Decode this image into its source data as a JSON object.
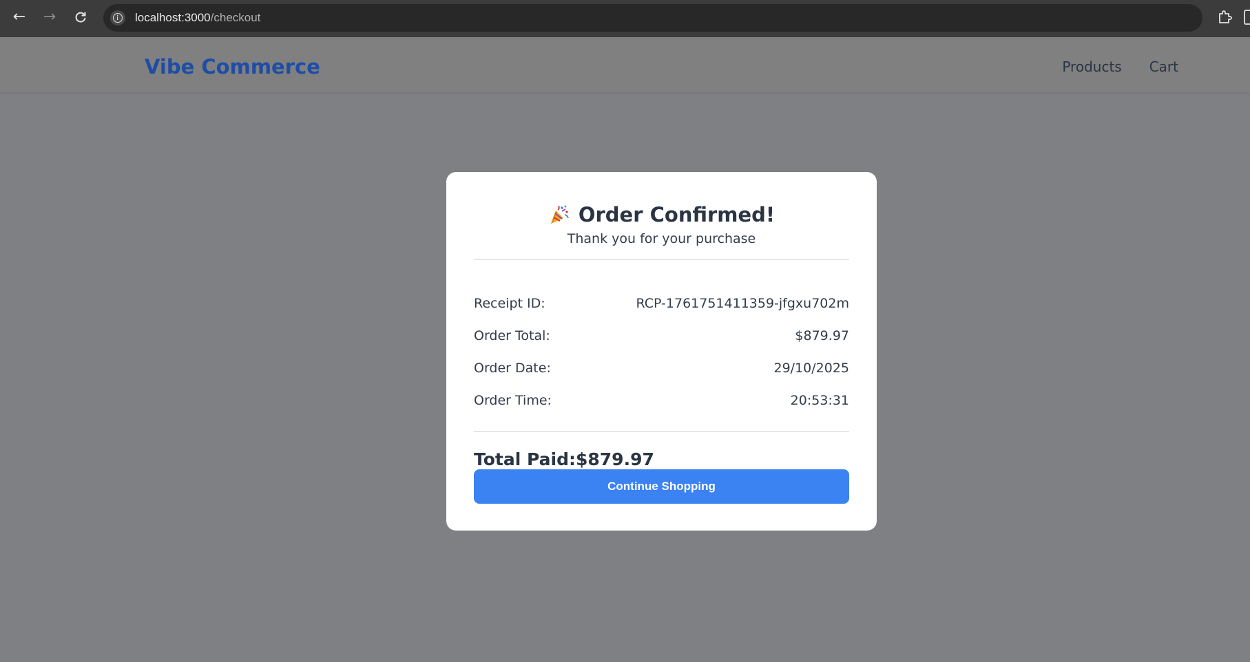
{
  "browser": {
    "url_host": "localhost:3000",
    "url_path": "/checkout"
  },
  "header": {
    "brand": "Vibe Commerce",
    "brand_color": "#1e4da6",
    "nav": [
      {
        "label": "Products"
      },
      {
        "label": "Cart"
      }
    ]
  },
  "modal": {
    "icon": "party-popper-icon",
    "title": "Order Confirmed!",
    "subtitle": "Thank you for your purchase",
    "details": [
      {
        "label": "Receipt ID:",
        "value": "RCP-1761751411359-jfgxu702m"
      },
      {
        "label": "Order Total:",
        "value": "$879.97"
      },
      {
        "label": "Order Date:",
        "value": "29/10/2025"
      },
      {
        "label": "Order Time:",
        "value": "20:53:31"
      }
    ],
    "total_label": "Total Paid:",
    "total_value": "$879.97",
    "button_label": "Continue Shopping",
    "button_color": "#3b82f2"
  }
}
